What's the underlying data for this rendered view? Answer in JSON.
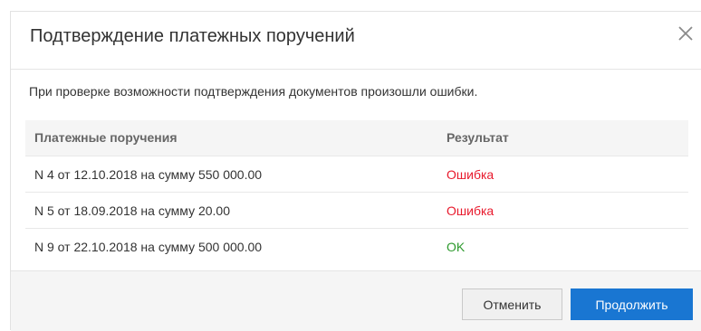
{
  "dialog": {
    "title": "Подтверждение платежных поручений",
    "message": "При проверке возможности подтверждения документов произошли ошибки.",
    "close_icon": "close-icon"
  },
  "table": {
    "headers": {
      "document": "Платежные поручения",
      "result": "Результат"
    },
    "rows": [
      {
        "document": "N 4 от 12.10.2018 на сумму 550 000.00",
        "result": "Ошибка"
      },
      {
        "document": "N 5 от 18.09.2018 на сумму 20.00",
        "result": "Ошибка"
      },
      {
        "document": "N 9 от 22.10.2018 на сумму 500 000.00",
        "result": "OK"
      }
    ]
  },
  "footer": {
    "cancel_label": "Отменить",
    "continue_label": "Продолжить"
  },
  "colors": {
    "error": "#e8192c",
    "ok": "#2e9a2e",
    "primary_button": "#1976d2"
  }
}
